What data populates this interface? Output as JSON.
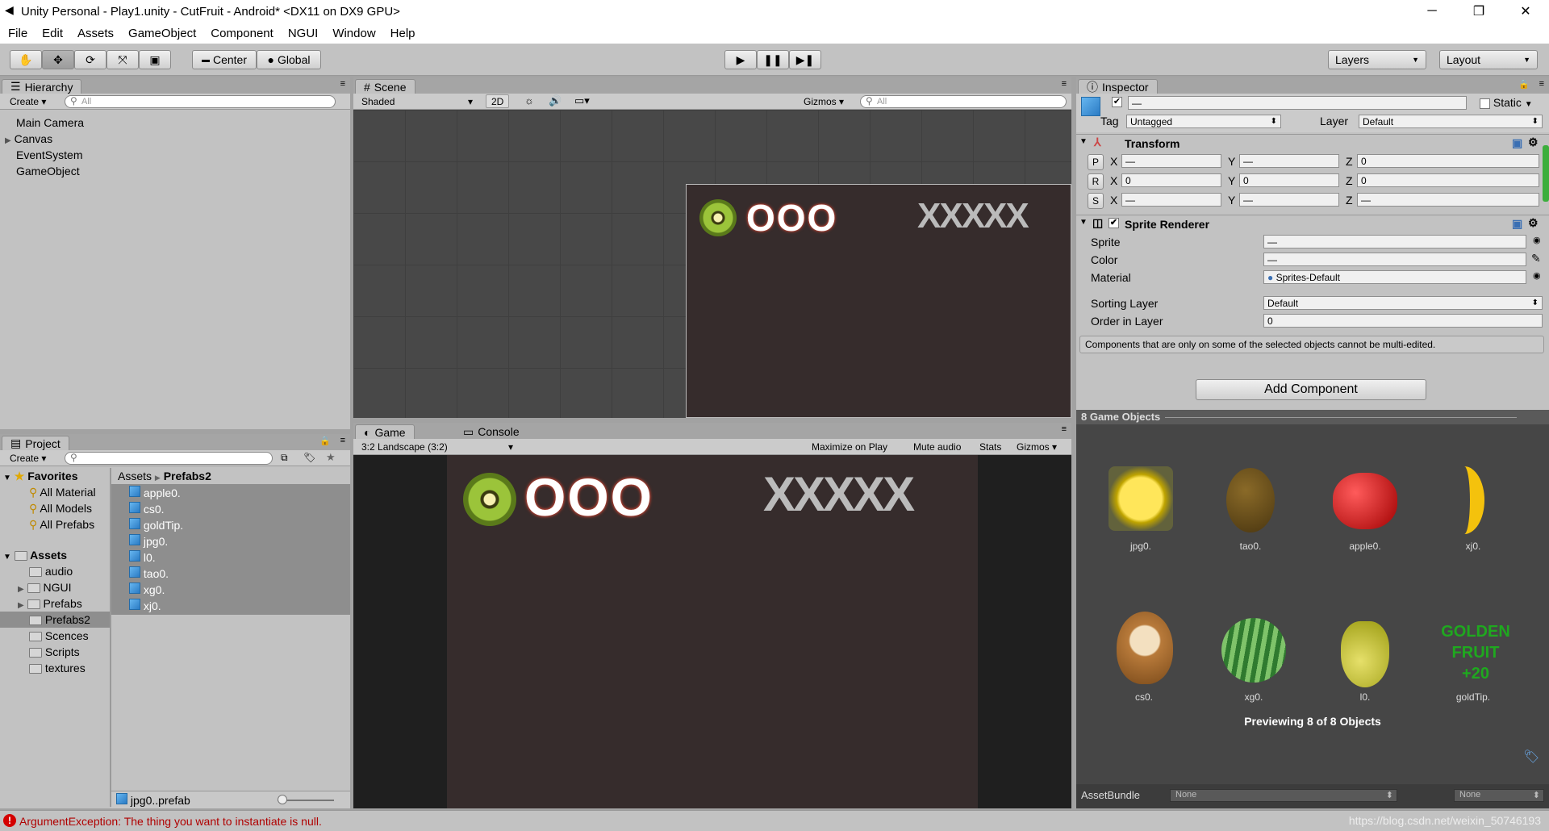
{
  "window": {
    "title": "Unity Personal - Play1.unity - CutFruit - Android* <DX11 on DX9 GPU>",
    "minimize": "─",
    "restore": "❐",
    "close": "✕"
  },
  "menu": [
    "File",
    "Edit",
    "Assets",
    "GameObject",
    "Component",
    "NGUI",
    "Window",
    "Help"
  ],
  "toolbar": {
    "center_label": "Center",
    "global_label": "Global",
    "layers": "Layers",
    "layout": "Layout"
  },
  "hierarchy": {
    "tab": "Hierarchy",
    "create": "Create",
    "search_placeholder": "All",
    "items": [
      "Main Camera",
      "Canvas",
      "EventSystem",
      "GameObject"
    ]
  },
  "scene": {
    "tab": "Scene",
    "shading": "Shaded",
    "mode2d": "2D",
    "gizmos": "Gizmos",
    "search_placeholder": "All"
  },
  "game": {
    "tab": "Game",
    "console_tab": "Console",
    "aspect": "3:2 Landscape (3:2)",
    "maximize": "Maximize on Play",
    "mute": "Mute audio",
    "stats": "Stats",
    "gizmos": "Gizmos",
    "score_glyphs": "OOO",
    "miss_glyphs": "XXXXX",
    "miss_glyphs_game": "XXXXX"
  },
  "project": {
    "tab": "Project",
    "create": "Create",
    "favorites_label": "Favorites",
    "favorites": [
      "All Material",
      "All Models",
      "All Prefabs"
    ],
    "assets_label": "Assets",
    "folders": [
      "audio",
      "NGUI",
      "Prefabs",
      "Prefabs2",
      "Scences",
      "Scripts",
      "textures"
    ],
    "breadcrumb_root": "Assets",
    "breadcrumb_current": "Prefabs2",
    "files": [
      "apple0.",
      "cs0.",
      "goldTip.",
      "jpg0.",
      "l0.",
      "tao0.",
      "xg0.",
      "xj0."
    ],
    "footer_file": "jpg0..prefab"
  },
  "inspector": {
    "tab": "Inspector",
    "name_value": "—",
    "static_label": "Static",
    "tag_label": "Tag",
    "tag_value": "Untagged",
    "layer_label": "Layer",
    "layer_value": "Default",
    "transform": {
      "title": "Transform",
      "rows": [
        {
          "btn": "P",
          "x": "—",
          "y": "—",
          "z": "0"
        },
        {
          "btn": "R",
          "x": "0",
          "y": "0",
          "z": "0"
        },
        {
          "btn": "S",
          "x": "—",
          "y": "—",
          "z": "—"
        }
      ],
      "x_label": "X",
      "y_label": "Y",
      "z_label": "Z"
    },
    "sprite_renderer": {
      "title": "Sprite Renderer",
      "sprite_label": "Sprite",
      "sprite_value": "—",
      "color_label": "Color",
      "color_value": "—",
      "material_label": "Material",
      "material_value": "Sprites-Default",
      "sorting_label": "Sorting Layer",
      "sorting_value": "Default",
      "order_label": "Order in Layer",
      "order_value": "0"
    },
    "note": "Components that are only on some of the selected objects cannot be multi-edited.",
    "add_component": "Add Component",
    "preview_title": "8 Game Objects",
    "preview_items": [
      "jpg0.",
      "tao0.",
      "apple0.",
      "xj0.",
      "cs0.",
      "xg0.",
      "l0.",
      "goldTip."
    ],
    "goldtip_text": [
      "GOLDEN",
      "FRUIT",
      "+20"
    ],
    "previewing": "Previewing 8 of 8 Objects",
    "assetbundle_label": "AssetBundle",
    "assetbundle_value": "None",
    "assetbundle_variant": "None"
  },
  "status": {
    "error": "ArgumentException: The thing you want to instantiate is null.",
    "watermark": "https://blog.csdn.net/weixin_50746193"
  }
}
